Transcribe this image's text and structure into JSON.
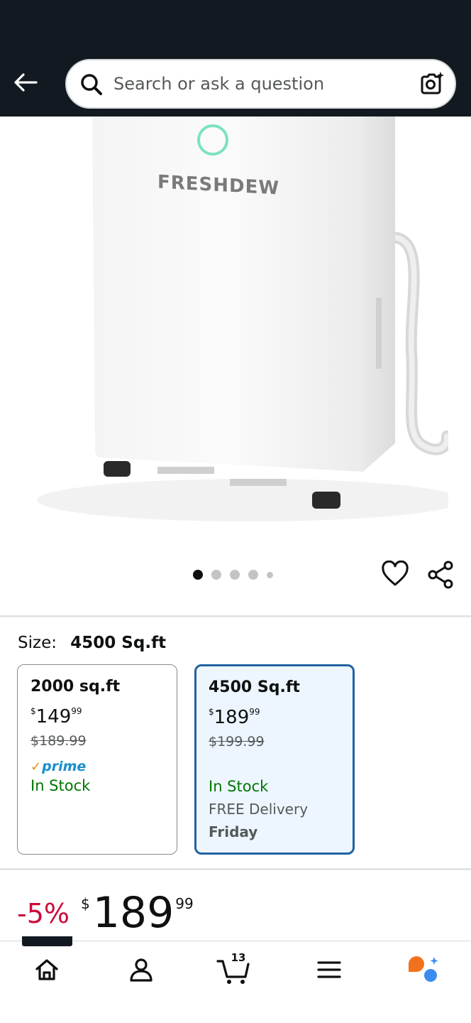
{
  "search": {
    "placeholder": "Search or ask a question"
  },
  "product": {
    "brand_logo": "FRESHDEW",
    "image_count": 5,
    "active_image": 1
  },
  "size": {
    "label": "Size:",
    "selected": "4500 Sq.ft",
    "options": [
      {
        "title": "2000 sq.ft",
        "price_symbol": "$",
        "price_whole": "149",
        "price_fraction": "99",
        "was_price": "$189.99",
        "prime": "prime",
        "stock": "In Stock",
        "delivery": "",
        "delivery_day": "",
        "selected": false
      },
      {
        "title": "4500 Sq.ft",
        "price_symbol": "$",
        "price_whole": "189",
        "price_fraction": "99",
        "was_price": "$199.99",
        "prime": "",
        "stock": "In Stock",
        "delivery": "FREE Delivery",
        "delivery_day": "Friday",
        "selected": true
      }
    ]
  },
  "price": {
    "discount": "-5%",
    "symbol": "$",
    "whole": "189",
    "fraction": "99"
  },
  "nav": {
    "cart_count": "13",
    "items": [
      "home-icon",
      "account-icon",
      "cart-icon",
      "menu-icon",
      "rufus-icon"
    ]
  },
  "colors": {
    "header_bg": "#131921",
    "selected_border": "#2162a1",
    "selected_bg": "#edf6ff",
    "discount_red": "#cc0c39",
    "in_stock_green": "#007600",
    "prime_blue": "#1a8ecb",
    "rufus_orange": "#f2711c",
    "rufus_blue": "#3c8cf0"
  }
}
